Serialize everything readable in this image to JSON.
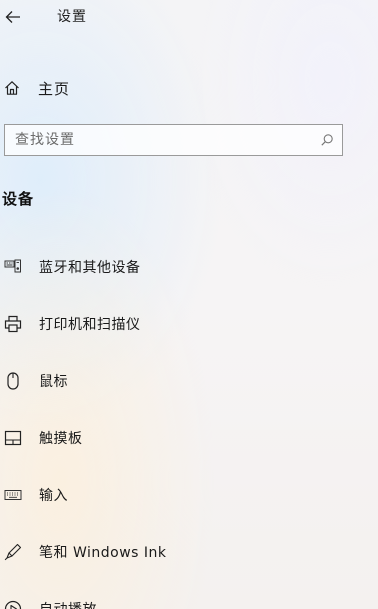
{
  "header": {
    "back_icon": "back-arrow-icon",
    "title": "设置"
  },
  "home": {
    "icon": "home-icon",
    "label": "主页"
  },
  "search": {
    "placeholder": "查找设置",
    "value": "",
    "icon": "search-icon"
  },
  "section": {
    "title": "设备"
  },
  "nav": {
    "items": [
      {
        "icon": "bluetooth-devices-icon",
        "label": "蓝牙和其他设备"
      },
      {
        "icon": "printer-icon",
        "label": "打印机和扫描仪"
      },
      {
        "icon": "mouse-icon",
        "label": "鼠标"
      },
      {
        "icon": "touchpad-icon",
        "label": "触摸板"
      },
      {
        "icon": "keyboard-icon",
        "label": "输入"
      },
      {
        "icon": "pen-icon",
        "label": "笔和 Windows Ink"
      },
      {
        "icon": "autoplay-icon",
        "label": "自动播放"
      }
    ]
  }
}
